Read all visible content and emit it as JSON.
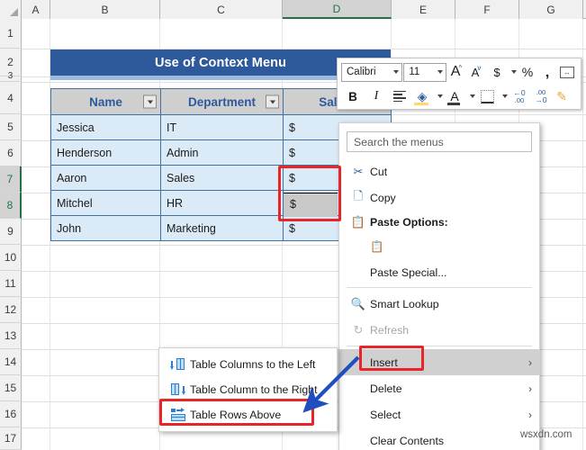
{
  "app": {
    "name": "excel-spreadsheet",
    "watermark": "wsxdn.com"
  },
  "grid": {
    "columns": [
      {
        "label": "A",
        "selected": false
      },
      {
        "label": "B",
        "selected": false
      },
      {
        "label": "C",
        "selected": false
      },
      {
        "label": "D",
        "selected": true
      },
      {
        "label": "E",
        "selected": false
      },
      {
        "label": "F",
        "selected": false
      },
      {
        "label": "G",
        "selected": false
      }
    ],
    "rows": [
      {
        "label": "1",
        "selected": false
      },
      {
        "label": "2",
        "selected": false
      },
      {
        "label": "3",
        "selected": false
      },
      {
        "label": "4",
        "selected": false
      },
      {
        "label": "5",
        "selected": false
      },
      {
        "label": "6",
        "selected": false
      },
      {
        "label": "7",
        "selected": true
      },
      {
        "label": "8",
        "selected": true
      },
      {
        "label": "9",
        "selected": false
      },
      {
        "label": "10",
        "selected": false
      },
      {
        "label": "11",
        "selected": false
      },
      {
        "label": "12",
        "selected": false
      },
      {
        "label": "13",
        "selected": false
      },
      {
        "label": "14",
        "selected": false
      },
      {
        "label": "15",
        "selected": false
      },
      {
        "label": "16",
        "selected": false
      },
      {
        "label": "17",
        "selected": false
      }
    ]
  },
  "banner": {
    "title": "Use of Context Menu",
    "color": "#2e5a9c"
  },
  "table": {
    "headers": [
      "Name",
      "Department",
      "Salary"
    ],
    "rows": [
      [
        "Jessica",
        "IT",
        "$"
      ],
      [
        "Henderson",
        "Admin",
        "$"
      ],
      [
        "Aaron",
        "Sales",
        "$"
      ],
      [
        "Mitchel",
        "HR",
        "$"
      ],
      [
        "John",
        "Marketing",
        "$"
      ]
    ],
    "active_cell_value": "$"
  },
  "mini_toolbar": {
    "font_name": "Calibri",
    "font_size": "11",
    "buttons": [
      "grow-font",
      "shrink-font",
      "currency-format",
      "percent-format",
      "comma-format",
      "merge-center",
      "bold",
      "italic",
      "align",
      "fill-color",
      "font-color",
      "borders",
      "decrease-decimal",
      "increase-decimal",
      "format-painter"
    ],
    "bold_label": "B",
    "italic_label": "I",
    "font_color_label": "A",
    "grow_font_label": "A",
    "shrink_font_label": "A",
    "currency_label": "$",
    "percent_label": "%",
    "comma_label": "‚",
    "decrease_decimal_label": ".00",
    "increase_decimal_label": ".00"
  },
  "context_menu": {
    "search_placeholder": "Search the menus",
    "items": [
      {
        "label": "Cut",
        "icon": "scissors-icon",
        "hover": false,
        "disabled": false,
        "arrow": "",
        "bold": false
      },
      {
        "label": "Copy",
        "icon": "copy-icon",
        "hover": false,
        "disabled": false,
        "arrow": "",
        "bold": false
      },
      {
        "label": "Paste Options:",
        "icon": "paste-icon",
        "hover": false,
        "disabled": false,
        "arrow": "",
        "bold": true
      },
      {
        "label": "Paste Special...",
        "icon": "",
        "hover": false,
        "disabled": false,
        "arrow": "",
        "bold": false
      },
      {
        "label": "Smart Lookup",
        "icon": "smart-lookup-icon",
        "hover": false,
        "disabled": false,
        "arrow": "",
        "bold": false
      },
      {
        "label": "Refresh",
        "icon": "refresh-icon",
        "hover": false,
        "disabled": true,
        "arrow": "",
        "bold": false
      },
      {
        "label": "Insert",
        "icon": "",
        "hover": true,
        "disabled": false,
        "arrow": "›",
        "bold": false
      },
      {
        "label": "Delete",
        "icon": "",
        "hover": false,
        "disabled": false,
        "arrow": "›",
        "bold": false
      },
      {
        "label": "Select",
        "icon": "",
        "hover": false,
        "disabled": false,
        "arrow": "›",
        "bold": false
      },
      {
        "label": "Clear Contents",
        "icon": "",
        "hover": false,
        "disabled": false,
        "arrow": "",
        "bold": false
      }
    ]
  },
  "submenu": {
    "items": [
      {
        "label": "Table Columns to the Left",
        "icon": "insert-column-left-icon",
        "highlighted": false
      },
      {
        "label": "Table Column to the Right",
        "icon": "insert-column-right-icon",
        "highlighted": false
      },
      {
        "label": "Table Rows Above",
        "icon": "insert-rows-above-icon",
        "highlighted": true
      }
    ]
  },
  "annotations": {
    "red_box_color": "#e8252a",
    "arrow_color": "#1f4fbf",
    "targets": [
      "selected-cells-d7-d8",
      "insert-menu-item",
      "table-rows-above-item"
    ]
  }
}
